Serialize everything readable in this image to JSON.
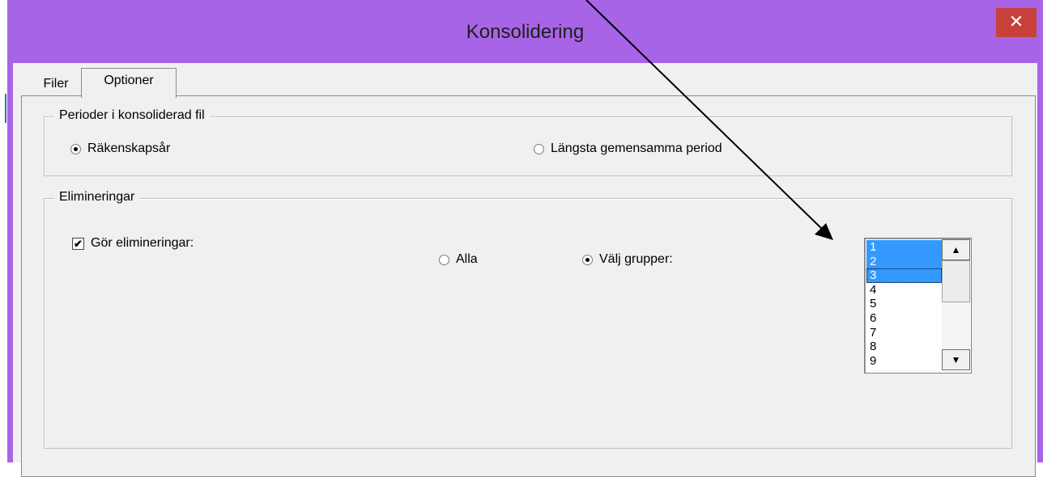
{
  "window": {
    "title": "Konsolidering",
    "close_glyph": "✕",
    "title_color": "#a864e6",
    "close_color": "#c7413a"
  },
  "tabs": [
    {
      "label": "Filer",
      "active": false
    },
    {
      "label": "Optioner",
      "active": true
    }
  ],
  "periods_group": {
    "title": "Perioder i konsoliderad fil",
    "options": [
      {
        "label": "Räkenskapsår",
        "selected": true
      },
      {
        "label": "Längsta gemensamma period",
        "selected": false
      }
    ]
  },
  "elim_group": {
    "title": "Elimineringar",
    "checkbox": {
      "label": "Gör elimineringar:",
      "checked": true
    },
    "options": [
      {
        "label": "Alla",
        "selected": false
      },
      {
        "label": "Välj grupper:",
        "selected": true
      }
    ],
    "groups_list": {
      "items": [
        "1",
        "2",
        "3",
        "4",
        "5",
        "6",
        "7",
        "8",
        "9"
      ],
      "selected": [
        "1",
        "2",
        "3"
      ],
      "focused": "3"
    }
  },
  "annotation": {
    "icon": "arrow-icon",
    "color": "#000000"
  }
}
